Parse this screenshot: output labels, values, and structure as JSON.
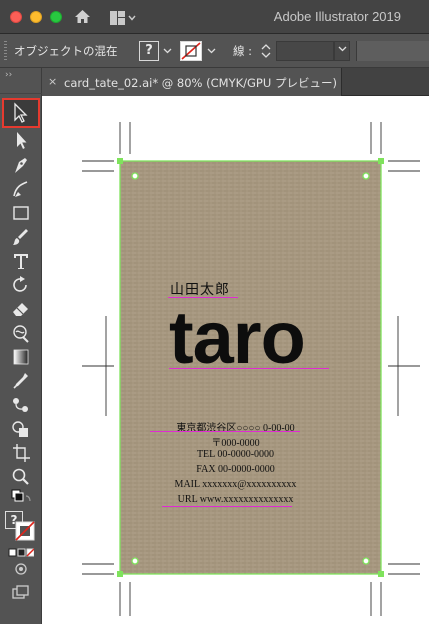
{
  "window": {
    "title": "Adobe Illustrator 2019"
  },
  "control_bar": {
    "selection_label": "オブジェクトの混在",
    "fill_swatch": "?",
    "stroke_label": "線 :"
  },
  "document_tab": {
    "close_glyph": "×",
    "label": "card_tate_02.ai* @ 80% (CMYK/GPU プレビュー)"
  },
  "toolbar": {
    "collapse_glyph": "››",
    "selected_tool": "selection",
    "tools": [
      "selection-tool",
      "direct-selection-tool",
      "pen-tool",
      "curvature-tool",
      "rectangle-tool",
      "paintbrush-tool",
      "type-tool",
      "rotate-tool",
      "eraser-tool",
      "warp-tool",
      "gradient-tool",
      "eyedropper-tool",
      "blend-tool",
      "shape-builder-tool",
      "artboard-tool",
      "zoom-tool"
    ],
    "fill_indicator": "?"
  },
  "card": {
    "name": "山田太郎",
    "big_name": "taro",
    "address_lines": [
      "東京都渋谷区○○○○ 0-00-00",
      "〒000-0000",
      "TEL 00-0000-0000",
      "FAX 00-0000-0000",
      "MAIL xxxxxxx@xxxxxxxxxx",
      "URL www.xxxxxxxxxxxxxx"
    ]
  },
  "colors": {
    "card_background": "#a6977f",
    "selection_bounding_box": "#7fe35c",
    "baseline_underline": "#e02bd2",
    "selected_tool_highlight": "#e53a2f"
  }
}
